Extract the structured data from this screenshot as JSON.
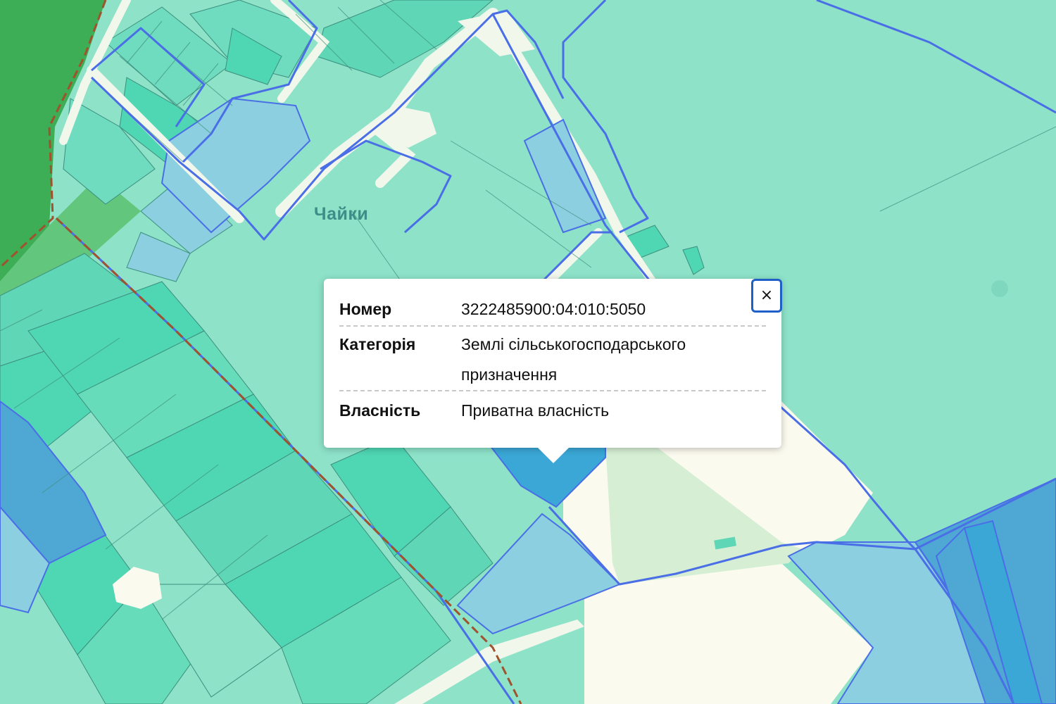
{
  "map": {
    "place_label": "Чайки",
    "colors": {
      "background": "#8de2c8",
      "parcel_dark": "#4fd6b3",
      "parcel_forest": "#3dae56",
      "parcel_blue": "#8ccfe0",
      "parcel_selected": "#3aa7d6",
      "road": "#f2f7ec",
      "boundary_line": "#4a6ee6",
      "admin_boundary": "#a0522d"
    }
  },
  "popup": {
    "rows": [
      {
        "label": "Номер",
        "value": "3222485900:04:010:5050"
      },
      {
        "label": "Категорія",
        "value": "Землі сільськогосподарського призначення"
      },
      {
        "label": "Власність",
        "value": "Приватна власність"
      }
    ],
    "close_label": "×"
  }
}
